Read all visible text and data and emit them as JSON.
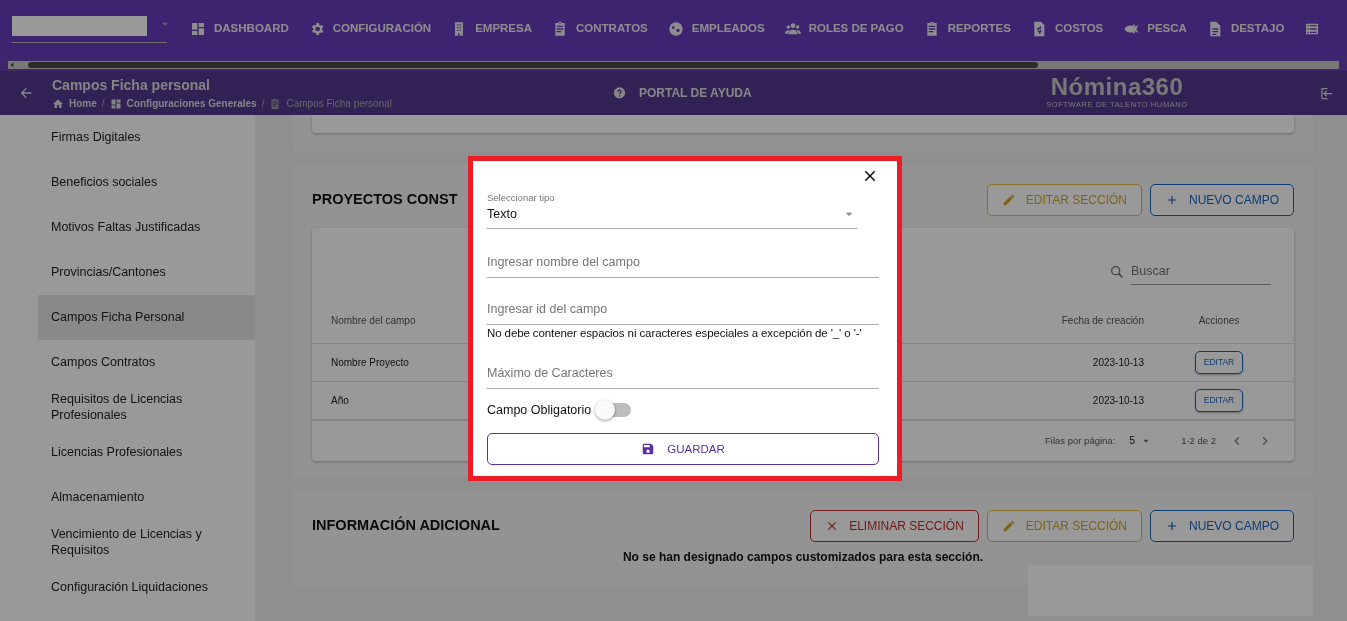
{
  "top_nav": {
    "items": [
      {
        "label": "DASHBOARD"
      },
      {
        "label": "CONFIGURACIÓN"
      },
      {
        "label": "EMPRESA"
      },
      {
        "label": "CONTRATOS"
      },
      {
        "label": "EMPLEADOS"
      },
      {
        "label": "ROLES DE PAGO"
      },
      {
        "label": "REPORTES"
      },
      {
        "label": "COSTOS"
      },
      {
        "label": "PESCA"
      },
      {
        "label": "DESTAJO"
      }
    ]
  },
  "header": {
    "title": "Campos Ficha personal",
    "breadcrumbs": [
      "Home",
      "Configuraciones Generales",
      "Campos Ficha personal"
    ],
    "breadcrumb_separator": "/",
    "help": "PORTAL DE AYUDA",
    "logo": "Nómina360",
    "tagline": "SOFTWARE DE TALENTO HUMANO"
  },
  "sidebar": {
    "items": [
      {
        "label": "Firmas Digitales",
        "selected": false
      },
      {
        "label": "Beneficios sociales",
        "selected": false
      },
      {
        "label": "Motivos Faltas Justificadas",
        "selected": false
      },
      {
        "label": "Provincias/Cantones",
        "selected": false
      },
      {
        "label": "Campos Ficha Personal",
        "selected": true
      },
      {
        "label": "Campos Contratos",
        "selected": false
      },
      {
        "label": "Requisitos de Licencias Profesionales",
        "selected": false
      },
      {
        "label": "Licencias Profesionales",
        "selected": false
      },
      {
        "label": "Almacenamiento",
        "selected": false
      },
      {
        "label": "Vencimiento de Licencias y Requisitos",
        "selected": false
      },
      {
        "label": "Configuración Liquidaciones",
        "selected": false
      }
    ]
  },
  "sections": [
    {
      "title": "PROYECTOS CONST",
      "buttons": [
        {
          "kind": "edit",
          "label": "EDITAR SECCIÓN"
        },
        {
          "kind": "add",
          "label": "NUEVO CAMPO"
        }
      ],
      "table": {
        "search": {
          "placeholder": "Buscar"
        },
        "columns": [
          "Nombre del campo",
          "Fecha de creación",
          "Acciones"
        ],
        "rows": [
          {
            "name": "Nombre Proyecto",
            "date": "2023-10-13",
            "action": "EDITAR"
          },
          {
            "name": "Año",
            "date": "2023-10-13",
            "action": "EDITAR"
          }
        ],
        "footer": {
          "rows_label": "Filas por página:",
          "rows_value": "5",
          "range": "1-2 de 2"
        }
      }
    },
    {
      "title": "INFORMACIÓN ADICIONAL",
      "buttons": [
        {
          "kind": "delete",
          "label": "ELIMINAR SECCIÓN"
        },
        {
          "kind": "edit",
          "label": "EDITAR SECCIÓN"
        },
        {
          "kind": "add",
          "label": "NUEVO CAMPO"
        }
      ],
      "message": "No se han designado campos customizados para esta sección."
    }
  ],
  "modal": {
    "type_select": {
      "label": "Seleccionar tipo",
      "value": "Texto"
    },
    "name_field": {
      "placeholder": "Ingresar nombre del campo"
    },
    "id_field": {
      "placeholder": "Ingresar id del campo",
      "hint": "No debe contener espacios ni caracteres especiales a excepción de '_' o '-'"
    },
    "max_field": {
      "placeholder": "Máximo de Caracteres"
    },
    "required_toggle": {
      "label": "Campo Obligatorio",
      "on": false
    },
    "save_button": {
      "label": "GUARDAR"
    }
  }
}
